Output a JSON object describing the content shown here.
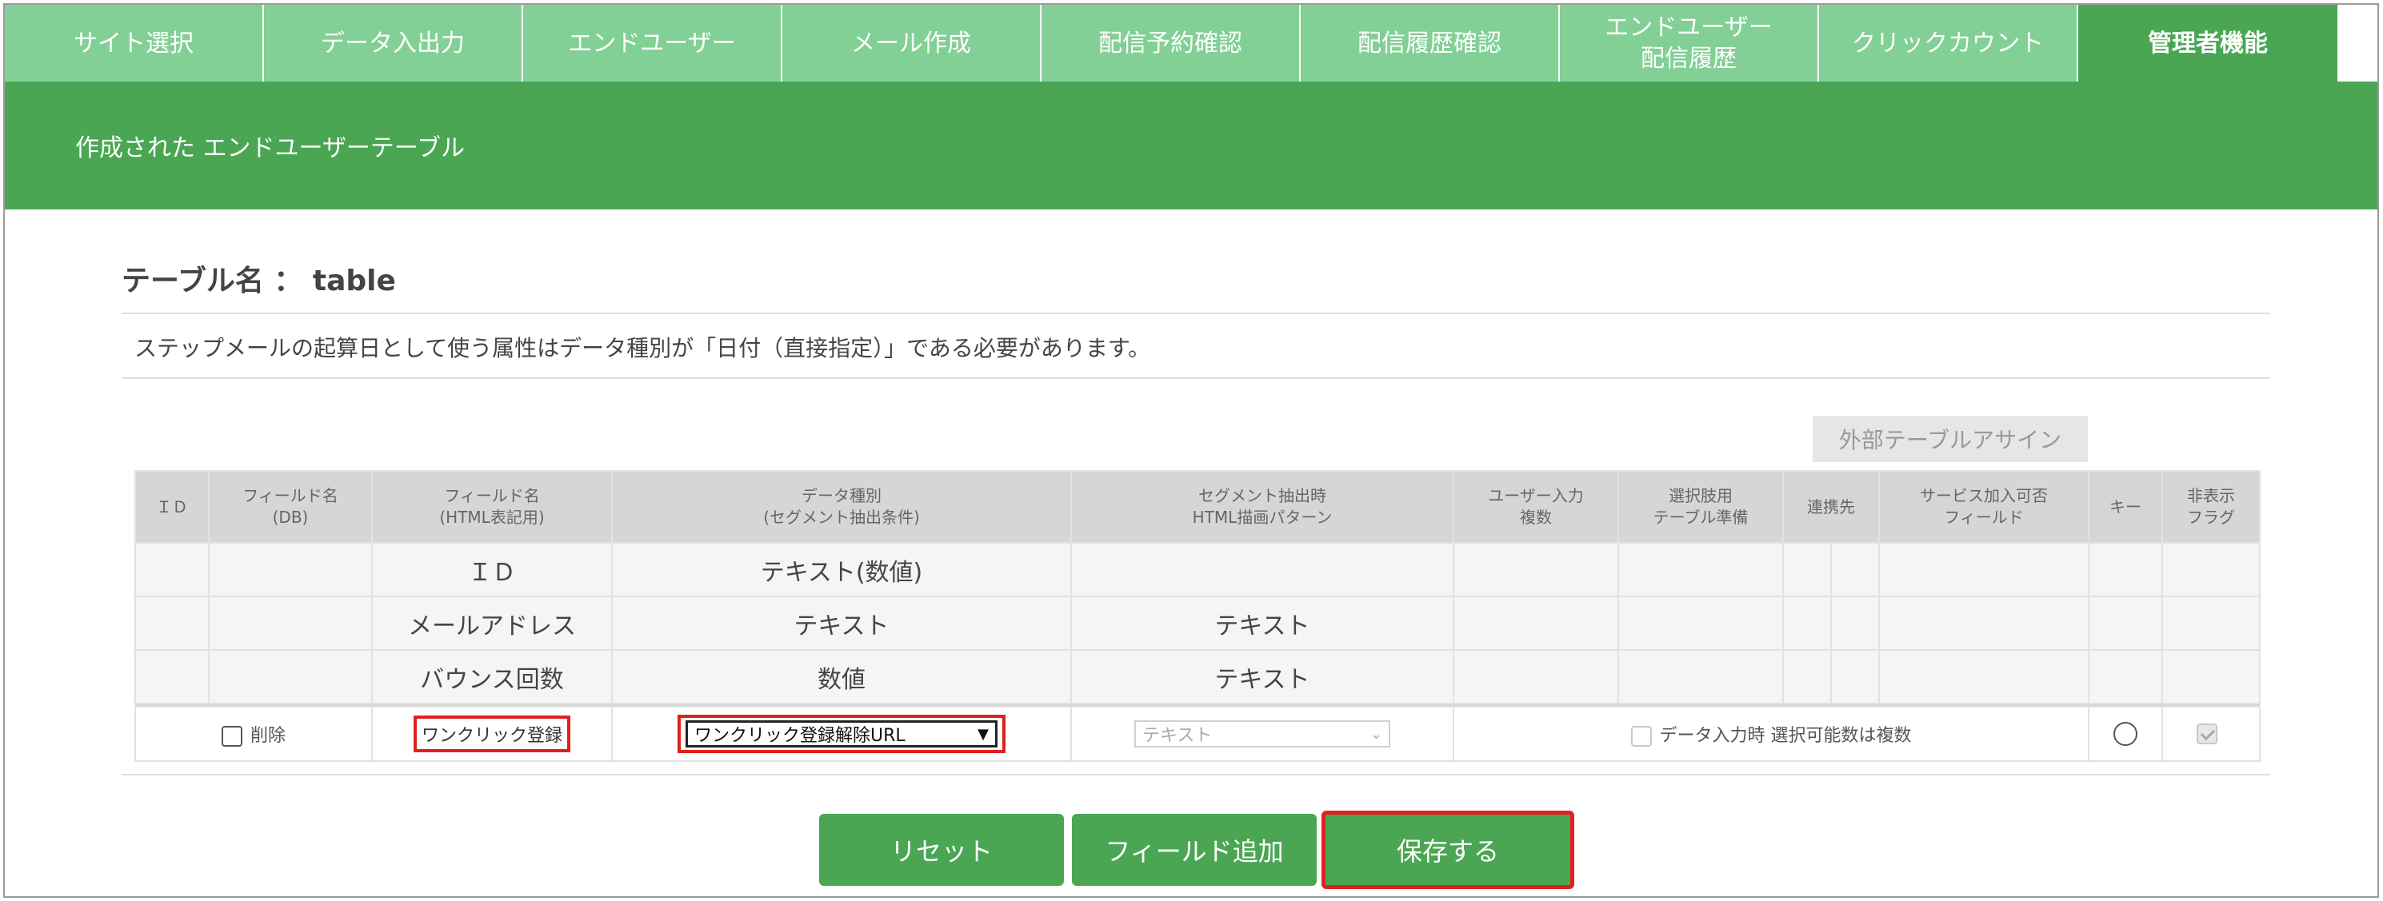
{
  "tabs": [
    {
      "line1": "サイト選択",
      "line2": ""
    },
    {
      "line1": "データ入出力",
      "line2": ""
    },
    {
      "line1": "エンドユーザー",
      "line2": ""
    },
    {
      "line1": "メール作成",
      "line2": ""
    },
    {
      "line1": "配信予約確認",
      "line2": ""
    },
    {
      "line1": "配信履歴確認",
      "line2": ""
    },
    {
      "line1": "エンドユーザー",
      "line2": "配信履歴"
    },
    {
      "line1": "クリックカウント",
      "line2": ""
    },
    {
      "line1": "管理者機能",
      "line2": ""
    }
  ],
  "banner": {
    "title": "作成された エンドユーザーテーブル"
  },
  "table_title": "テーブル名 ： table",
  "notice": "ステップメールの起算日として使う属性はデータ種別が「日付（直接指定）」である必要があります。",
  "external_button": "外部テーブルアサイン",
  "headers": [
    {
      "l1": "ＩＤ",
      "l2": ""
    },
    {
      "l1": "フィールド名",
      "l2": "(DB)"
    },
    {
      "l1": "フィールド名",
      "l2": "(HTML表記用)"
    },
    {
      "l1": "データ種別",
      "l2": "(セグメント抽出条件)"
    },
    {
      "l1": "セグメント抽出時",
      "l2": "HTML描画パターン"
    },
    {
      "l1": "ユーザー入力",
      "l2": "複数"
    },
    {
      "l1": "選択肢用",
      "l2": "テーブル準備"
    },
    {
      "l1": "連携先",
      "l2": ""
    },
    {
      "l1": "サービス加入可否",
      "l2": "フィールド"
    },
    {
      "l1": "キー",
      "l2": ""
    },
    {
      "l1": "非表示",
      "l2": "フラグ"
    }
  ],
  "rows": [
    {
      "html_name": "ＩＤ",
      "type": "テキスト(数値)",
      "pattern": ""
    },
    {
      "html_name": "メールアドレス",
      "type": "テキスト",
      "pattern": "テキスト"
    },
    {
      "html_name": "バウンス回数",
      "type": "数値",
      "pattern": "テキスト"
    }
  ],
  "new_row": {
    "delete_label": "削除",
    "html_name_value": "ワンクリック登録",
    "type_selected": "ワンクリック登録解除URL",
    "pattern_selected": "テキスト",
    "multi_label": "データ入力時 選択可能数は複数"
  },
  "buttons": {
    "reset": "リセット",
    "add_field": "フィールド追加",
    "save": "保存する"
  }
}
